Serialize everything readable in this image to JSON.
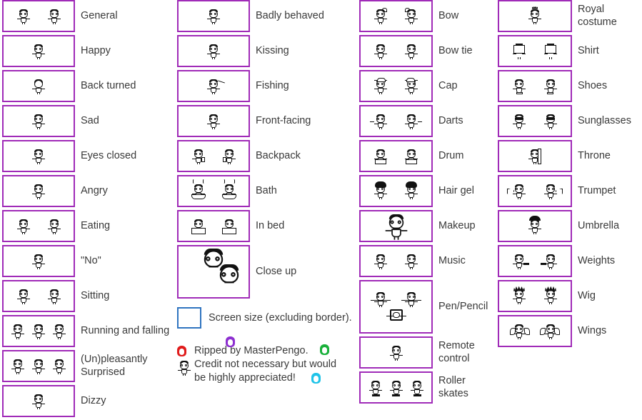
{
  "meta": {
    "title": "Sprite sheet reference",
    "box_border_color": "#a02bb8",
    "screen_box_border_color": "#2f74c0",
    "text_color": "#3a3a3a",
    "background": "#ffffff"
  },
  "columns": [
    {
      "id": "column-1",
      "entries": [
        {
          "label": "General",
          "sprite_count": 2,
          "tall": false,
          "variant": "general"
        },
        {
          "label": "Happy",
          "sprite_count": 1,
          "tall": false,
          "variant": "happy"
        },
        {
          "label": "Back turned",
          "sprite_count": 1,
          "tall": false,
          "variant": "back"
        },
        {
          "label": "Sad",
          "sprite_count": 1,
          "tall": false,
          "variant": "sad"
        },
        {
          "label": "Eyes closed",
          "sprite_count": 1,
          "tall": false,
          "variant": "eyes-closed"
        },
        {
          "label": "Angry",
          "sprite_count": 1,
          "tall": false,
          "variant": "angry"
        },
        {
          "label": "Eating",
          "sprite_count": 2,
          "tall": false,
          "variant": "eating"
        },
        {
          "label": "\"No\"",
          "sprite_count": 1,
          "tall": false,
          "variant": "no"
        },
        {
          "label": "Sitting",
          "sprite_count": 2,
          "tall": false,
          "variant": "sitting"
        },
        {
          "label": "Running and falling",
          "sprite_count": 3,
          "tall": false,
          "variant": "running"
        },
        {
          "label": "(Un)pleasantly\nSurprised",
          "sprite_count": 3,
          "tall": false,
          "variant": "surprised"
        },
        {
          "label": "Dizzy",
          "sprite_count": 1,
          "tall": false,
          "variant": "dizzy"
        }
      ]
    },
    {
      "id": "column-2",
      "entries": [
        {
          "label": "Badly behaved",
          "sprite_count": 1,
          "tall": false,
          "variant": "badly"
        },
        {
          "label": "Kissing",
          "sprite_count": 1,
          "tall": false,
          "variant": "kissing"
        },
        {
          "label": "Fishing",
          "sprite_count": 1,
          "tall": false,
          "variant": "fishing"
        },
        {
          "label": "Front-facing",
          "sprite_count": 1,
          "tall": false,
          "variant": "front"
        },
        {
          "label": "Backpack",
          "sprite_count": 2,
          "tall": false,
          "variant": "backpack"
        },
        {
          "label": "Bath",
          "sprite_count": 2,
          "tall": false,
          "variant": "bath"
        },
        {
          "label": "In bed",
          "sprite_count": 2,
          "tall": false,
          "variant": "bed"
        },
        {
          "label": "Close up",
          "sprite_count": 3,
          "tall": true,
          "variant": "closeup"
        }
      ],
      "screen_size": {
        "label": "Screen size (excluding border).",
        "border_color": "#2f74c0"
      },
      "credit": {
        "line1": "Ripped by MasterPengo.",
        "line2": "Credit not necessary but would",
        "line3": "be highly appreciated!",
        "icon_colors": [
          "#e01b1b",
          "#8d2fd0",
          "#19b03a",
          "#1fc3e8"
        ]
      }
    },
    {
      "id": "column-3",
      "entries": [
        {
          "label": "Bow",
          "sprite_count": 2,
          "tall": false,
          "variant": "bow"
        },
        {
          "label": "Bow tie",
          "sprite_count": 2,
          "tall": false,
          "variant": "bowtie"
        },
        {
          "label": "Cap",
          "sprite_count": 2,
          "tall": false,
          "variant": "cap"
        },
        {
          "label": "Darts",
          "sprite_count": 2,
          "tall": false,
          "variant": "darts"
        },
        {
          "label": "Drum",
          "sprite_count": 2,
          "tall": false,
          "variant": "drum"
        },
        {
          "label": "Hair gel",
          "sprite_count": 2,
          "tall": false,
          "variant": "hairgel"
        },
        {
          "label": "Makeup",
          "sprite_count": 1,
          "tall": false,
          "variant": "makeup"
        },
        {
          "label": "Music",
          "sprite_count": 2,
          "tall": false,
          "variant": "music"
        },
        {
          "label": "Pen/Pencil",
          "sprite_count": 3,
          "tall": true,
          "variant": "pen"
        },
        {
          "label": "Remote\ncontrol",
          "sprite_count": 1,
          "tall": false,
          "variant": "remote"
        },
        {
          "label": "Roller\nskates",
          "sprite_count": 3,
          "tall": false,
          "variant": "skates"
        }
      ]
    },
    {
      "id": "column-4",
      "entries": [
        {
          "label": "Royal\ncostume",
          "sprite_count": 1,
          "tall": false,
          "variant": "royal"
        },
        {
          "label": "Shirt",
          "sprite_count": 2,
          "tall": false,
          "variant": "shirt"
        },
        {
          "label": "Shoes",
          "sprite_count": 2,
          "tall": false,
          "variant": "shoes"
        },
        {
          "label": "Sunglasses",
          "sprite_count": 2,
          "tall": false,
          "variant": "sunglasses"
        },
        {
          "label": "Throne",
          "sprite_count": 1,
          "tall": false,
          "variant": "throne"
        },
        {
          "label": "Trumpet",
          "sprite_count": 2,
          "tall": false,
          "variant": "trumpet"
        },
        {
          "label": "Umbrella",
          "sprite_count": 1,
          "tall": false,
          "variant": "umbrella"
        },
        {
          "label": "Weights",
          "sprite_count": 2,
          "tall": false,
          "variant": "weights"
        },
        {
          "label": "Wig",
          "sprite_count": 2,
          "tall": false,
          "variant": "wig"
        },
        {
          "label": "Wings",
          "sprite_count": 2,
          "tall": false,
          "variant": "wings"
        }
      ]
    }
  ]
}
